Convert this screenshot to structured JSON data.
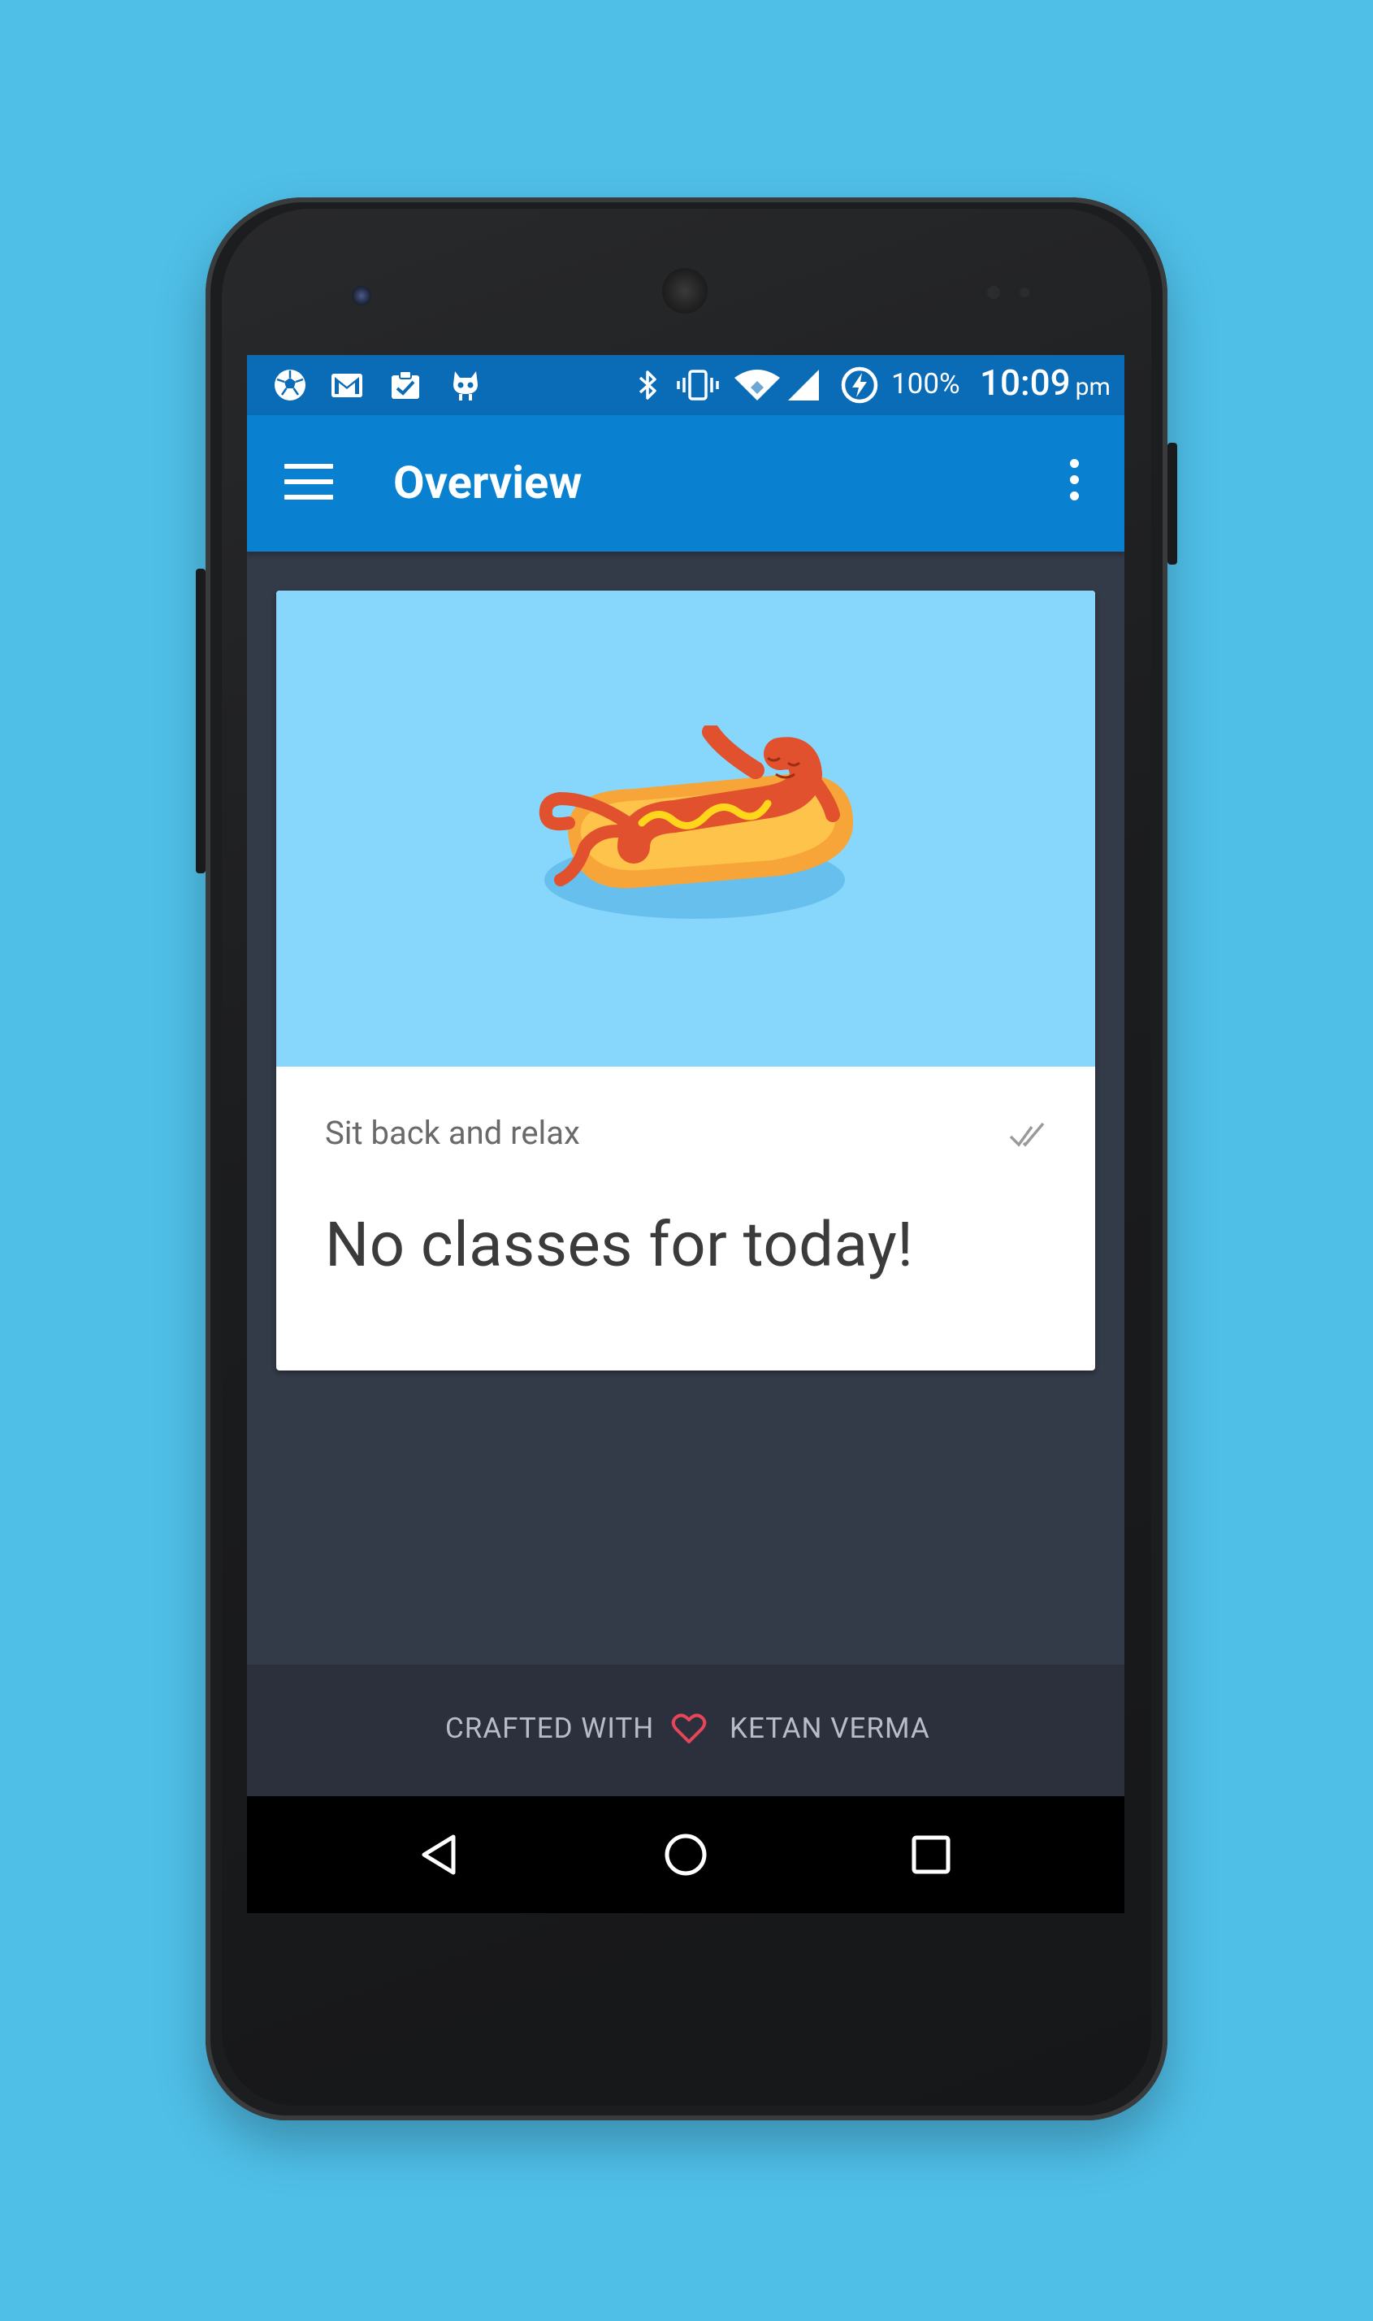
{
  "status_bar": {
    "battery_percent": "100%",
    "time": "10:09",
    "time_suffix": "pm",
    "notification_icons": [
      "soccer-ball-icon",
      "gmail-icon",
      "clipboard-check-icon",
      "cyanogen-mascot-icon"
    ],
    "system_icons": [
      "bluetooth-icon",
      "vibrate-icon",
      "wifi-icon",
      "cell-signal-icon",
      "battery-charging-icon"
    ]
  },
  "app_bar": {
    "title": "Overview",
    "nav_icon": "menu-icon",
    "overflow_icon": "more-vert-icon"
  },
  "card": {
    "illustration": "relaxing-hotdog-illustration",
    "label": "Sit back and relax",
    "status_icon": "done-all-icon",
    "headline": "No classes for today!"
  },
  "footer": {
    "left_text": "CRAFTED WITH",
    "icon": "heart-icon",
    "right_text": "KETAN VERMA"
  },
  "nav_bar": {
    "buttons": [
      "back-icon",
      "home-icon",
      "recents-icon"
    ]
  },
  "colors": {
    "background": "#4fbfe8",
    "status_bar": "#0a6bb6",
    "app_bar": "#0a80d0",
    "screen_background": "#333a48",
    "card_hero": "#86d7fb",
    "footer": "#2b303c",
    "heart": "#e8445a"
  }
}
